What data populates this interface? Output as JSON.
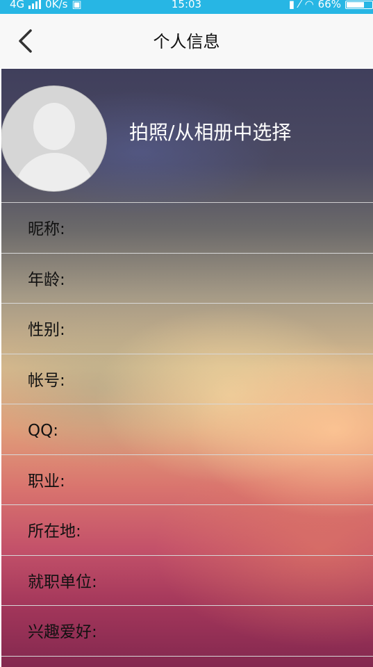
{
  "status_bar": {
    "network": "4G",
    "speed": "0K/s",
    "time": "15:03",
    "battery": "66%"
  },
  "header": {
    "title": "个人信息",
    "back_icon": "chevron-left-icon"
  },
  "profile": {
    "avatar_icon": "default-avatar-icon",
    "photo_action_label": "拍照/从相册中选择"
  },
  "fields": [
    {
      "label": "昵称:"
    },
    {
      "label": "年龄:"
    },
    {
      "label": "性别:"
    },
    {
      "label": "帐号:"
    },
    {
      "label": "QQ:"
    },
    {
      "label": "职业:"
    },
    {
      "label": "所在地:"
    },
    {
      "label": "就职单位:"
    },
    {
      "label": "兴趣爱好:"
    }
  ],
  "colors": {
    "status_bar": "#27b6e4",
    "nav_bar": "#f8f8f8"
  }
}
